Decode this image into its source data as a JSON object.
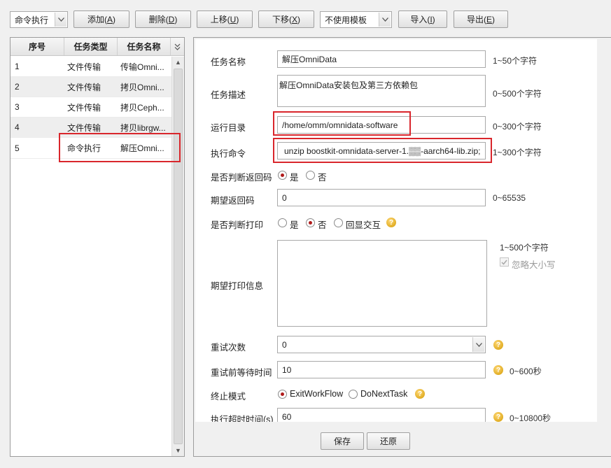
{
  "toolbar": {
    "mode_select": "命令执行",
    "add": "添加",
    "add_key": "A",
    "delete": "删除",
    "delete_key": "D",
    "move_up": "上移",
    "move_up_key": "U",
    "move_down": "下移",
    "move_down_key": "X",
    "template_select": "不使用模板",
    "import": "导入",
    "import_key": "I",
    "export": "导出",
    "export_key": "E"
  },
  "task_list": {
    "headers": [
      "序号",
      "任务类型",
      "任务名称"
    ],
    "rows": [
      {
        "no": "1",
        "type": "文件传输",
        "name": "传输Omni..."
      },
      {
        "no": "2",
        "type": "文件传输",
        "name": "拷贝Omni..."
      },
      {
        "no": "3",
        "type": "文件传输",
        "name": "拷贝Ceph..."
      },
      {
        "no": "4",
        "type": "文件传输",
        "name": "拷贝librgw..."
      },
      {
        "no": "5",
        "type": "命令执行",
        "name": "解压Omni..."
      }
    ]
  },
  "form": {
    "task_name": {
      "label": "任务名称",
      "value": "解压OmniData",
      "hint": "1~50个字符"
    },
    "task_desc": {
      "label": "任务描述",
      "value": "解压OmniData安装包及第三方依赖包",
      "hint": "0~500个字符"
    },
    "run_dir": {
      "label": "运行目录",
      "value": "/home/omm/omnidata-software",
      "hint": "0~300个字符"
    },
    "exec_cmd": {
      "label": "执行命令",
      "value": "unzip boostkit-omnidata-server-1.▒▒-aarch64-lib.zip;",
      "hint": "1~300个字符"
    },
    "check_return": {
      "label": "是否判断返回码",
      "opt_yes": "是",
      "opt_no": "否",
      "selected": "是"
    },
    "expected_return": {
      "label": "期望返回码",
      "value": "0",
      "hint": "0~65535"
    },
    "check_print": {
      "label": "是否判断打印",
      "opt_yes": "是",
      "opt_no": "否",
      "opt_echo": "回显交互",
      "selected": "否"
    },
    "expected_print": {
      "label": "期望打印信息",
      "value": "",
      "hint": "1~500个字符",
      "ignore_case": "忽略大小写"
    },
    "retry_count": {
      "label": "重试次数",
      "value": "0"
    },
    "retry_wait": {
      "label": "重试前等待时间",
      "value": "10",
      "hint": "0~600秒"
    },
    "stop_mode": {
      "label": "终止模式",
      "opt_exit": "ExitWorkFlow",
      "opt_next": "DoNextTask",
      "selected": "ExitWorkFlow"
    },
    "timeout": {
      "label": "执行超时时间(s)",
      "value": "60",
      "hint": "0~10800秒"
    }
  },
  "footer": {
    "save": "保存",
    "restore": "还原"
  },
  "colors": {
    "highlight": "#d9262c",
    "radio_dot": "#b01b1b",
    "help_icon": "#e0a400"
  }
}
